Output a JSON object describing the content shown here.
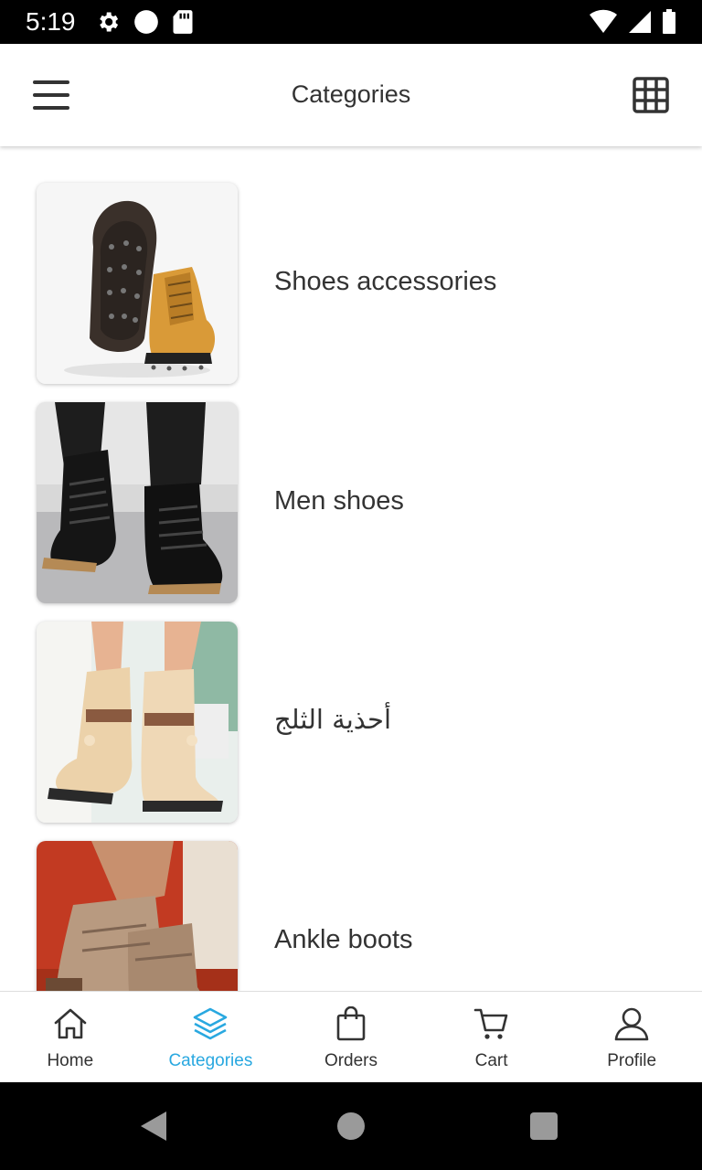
{
  "status_bar": {
    "time": "5:19",
    "icons_left": [
      "gear-icon",
      "circle-icon",
      "sd-card-icon"
    ],
    "icons_right": [
      "wifi-icon",
      "signal-icon",
      "battery-icon"
    ]
  },
  "app_bar": {
    "title": "Categories",
    "left_icon": "menu-icon",
    "right_icon": "grid-view-icon"
  },
  "categories": [
    {
      "label": "Shoes accessories",
      "image": "shoe-ice-cleats-image"
    },
    {
      "label": "Men shoes",
      "image": "black-chelsea-boots-image"
    },
    {
      "label": "أحذية الثلج",
      "image": "fur-snow-boots-image"
    },
    {
      "label": "Ankle boots",
      "image": "tan-ankle-boots-image"
    }
  ],
  "bottom_nav": {
    "items": [
      {
        "label": "Home",
        "icon": "home-icon"
      },
      {
        "label": "Categories",
        "icon": "layers-icon"
      },
      {
        "label": "Orders",
        "icon": "shopping-bag-icon"
      },
      {
        "label": "Cart",
        "icon": "cart-icon"
      },
      {
        "label": "Profile",
        "icon": "user-icon"
      }
    ],
    "active": "Categories"
  },
  "colors": {
    "accent": "#29a8e0",
    "text": "#333333",
    "status_bar": "#000000"
  }
}
